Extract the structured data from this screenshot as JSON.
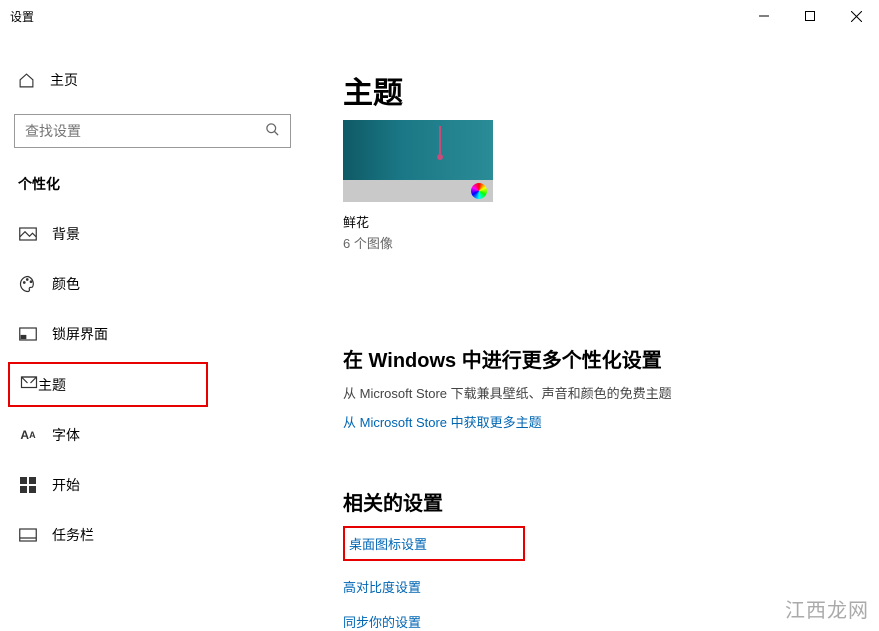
{
  "window": {
    "title": "设置"
  },
  "sidebar": {
    "home": "主页",
    "search_placeholder": "查找设置",
    "section": "个性化",
    "items": [
      {
        "label": "背景"
      },
      {
        "label": "颜色"
      },
      {
        "label": "锁屏界面"
      },
      {
        "label": "主题"
      },
      {
        "label": "字体"
      },
      {
        "label": "开始"
      },
      {
        "label": "任务栏"
      }
    ]
  },
  "main": {
    "title": "主题",
    "theme_name": "鲜花",
    "theme_sub": "6 个图像",
    "more_heading": "在 Windows 中进行更多个性化设置",
    "more_desc": "从 Microsoft Store 下载兼具壁纸、声音和颜色的免费主题",
    "store_link": "从 Microsoft Store 中获取更多主题",
    "related_heading": "相关的设置",
    "links": [
      "桌面图标设置",
      "高对比度设置",
      "同步你的设置"
    ]
  },
  "watermark": "江西龙网"
}
